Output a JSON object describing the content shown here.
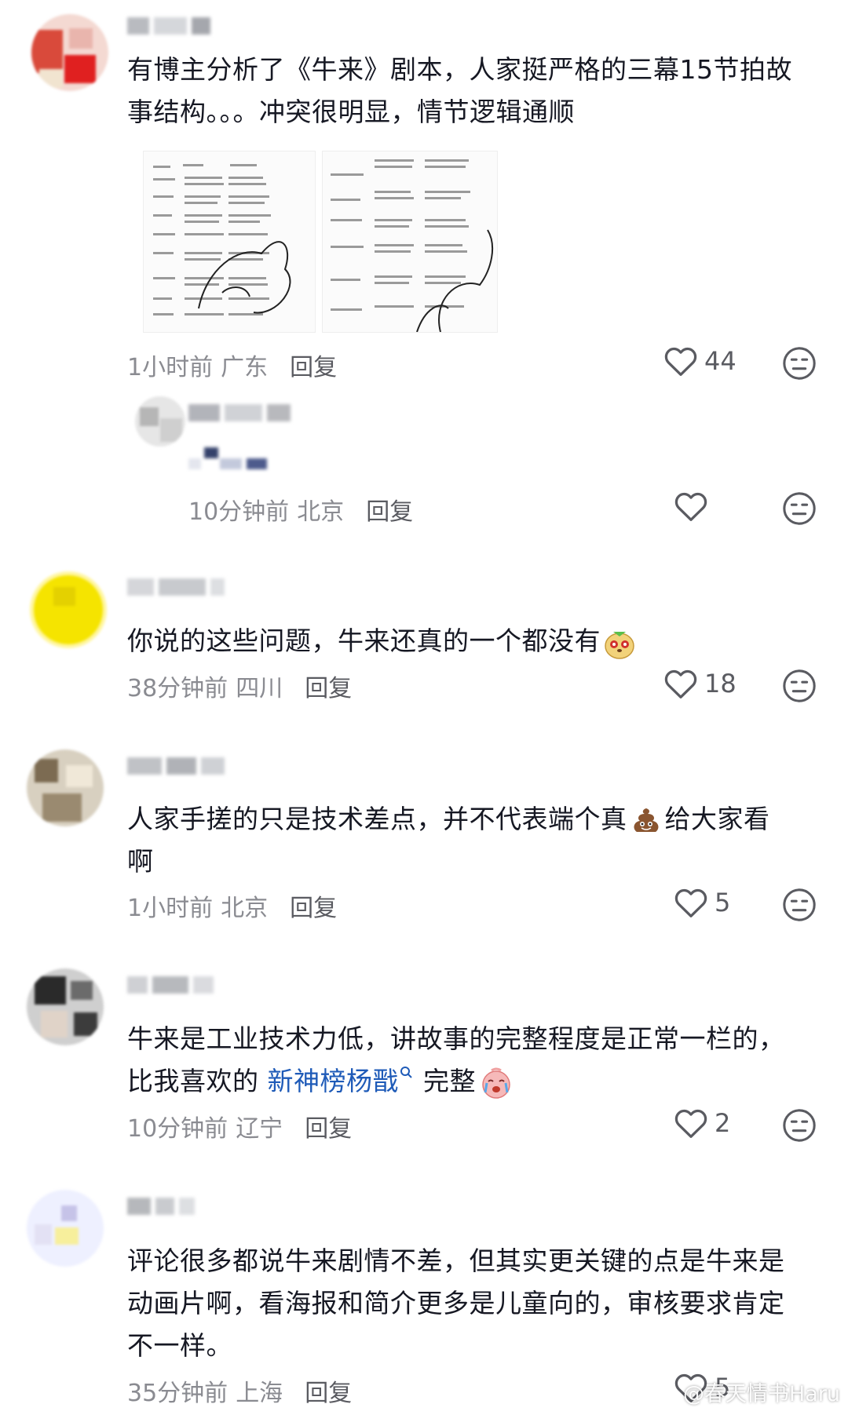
{
  "comments": [
    {
      "text_lines": [
        "有博主分析了《牛来》剧本，人家挺严格的三幕15节拍故",
        "事结构。。。冲突很明显，情节逻辑通顺"
      ],
      "time": "1小时前",
      "location": "广东",
      "reply": "回复",
      "likes": "44",
      "images": [
        {
          "name": "script-page-1"
        },
        {
          "name": "script-page-2"
        }
      ]
    },
    {
      "text_lines": [],
      "time": "10分钟前",
      "location": "北京",
      "reply": "回复",
      "likes": ""
    },
    {
      "text_lines": [
        "你说的这些问题，牛来还真的一个都没有"
      ],
      "time": "38分钟前",
      "location": "四川",
      "reply": "回复",
      "likes": "18"
    },
    {
      "text_lines": [
        "人家手搓的只是技术差点，并不代表端个真",
        "啊"
      ],
      "after_emoji_text": "给大家看",
      "time": "1小时前",
      "location": "北京",
      "reply": "回复",
      "likes": "5"
    },
    {
      "text_lines": [
        "牛来是工业技术力低，讲故事的完整程度是正常一栏的，",
        "比我喜欢的 "
      ],
      "link_text": "新神榜杨戬",
      "after_link_text": " 完整",
      "time": "10分钟前",
      "location": "辽宁",
      "reply": "回复",
      "likes": "2"
    },
    {
      "text_lines": [
        "评论很多都说牛来剧情不差，但其实更关键的点是牛来是",
        "动画片啊，看海报和简介更多是儿童向的，审核要求肯定",
        "不一样。"
      ],
      "time": "35分钟前",
      "location": "上海",
      "reply": "回复",
      "likes": "5"
    }
  ],
  "watermark": "@春天情书Haru",
  "colors": {
    "text": "#161823",
    "meta": "#8a8b91",
    "link": "#1f5bb8"
  },
  "icons": [
    "heart-icon",
    "dislike-icon",
    "search-icon",
    "weibo-logo"
  ]
}
